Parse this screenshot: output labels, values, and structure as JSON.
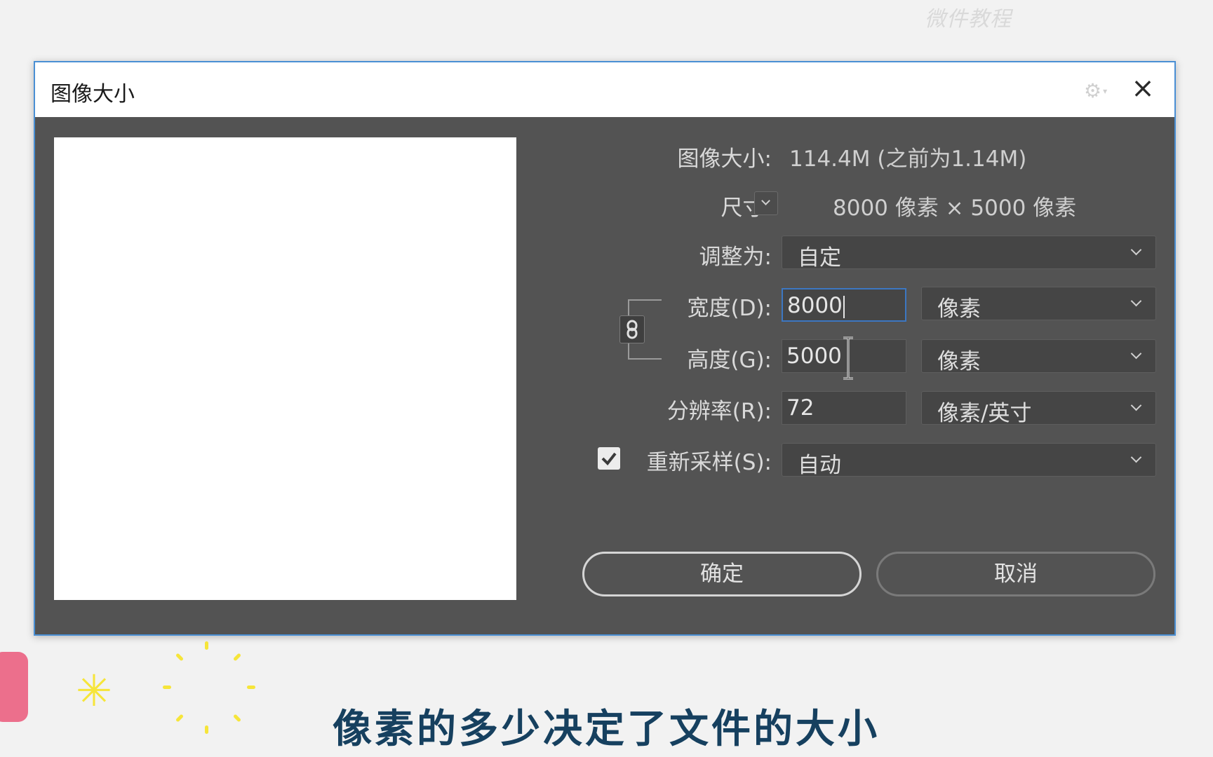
{
  "watermark": "微件教程",
  "dialog": {
    "title": "图像大小",
    "close_icon": "×"
  },
  "info": {
    "image_size_label": "图像大小:",
    "image_size_value": "114.4M (之前为1.14M)",
    "dimensions_label": "尺寸:",
    "dimensions_value": "8000 像素 × 5000 像素"
  },
  "fit_to": {
    "label": "调整为:",
    "value": "自定"
  },
  "width": {
    "label": "宽度(D):",
    "value": "8000",
    "unit": "像素"
  },
  "height": {
    "label": "高度(G):",
    "value": "5000",
    "unit": "像素"
  },
  "resolution": {
    "label": "分辨率(R):",
    "value": "72",
    "unit": "像素/英寸"
  },
  "resample": {
    "label": "重新采样(S):",
    "checked": true,
    "value": "自动"
  },
  "buttons": {
    "ok": "确定",
    "cancel": "取消"
  },
  "caption": "像素的多少决定了文件的大小",
  "icons": {
    "gear": "gear-icon",
    "link": "chain-link-icon",
    "close": "close-icon",
    "check": "checkmark-icon",
    "cursor": "text-ibeam-cursor-icon"
  },
  "colors": {
    "dialog_bg": "#535353",
    "focus_border": "#3c77c2",
    "caption": "#16405f",
    "accent_pink": "#ec6f8c",
    "accent_yellow": "#f6e53a"
  }
}
